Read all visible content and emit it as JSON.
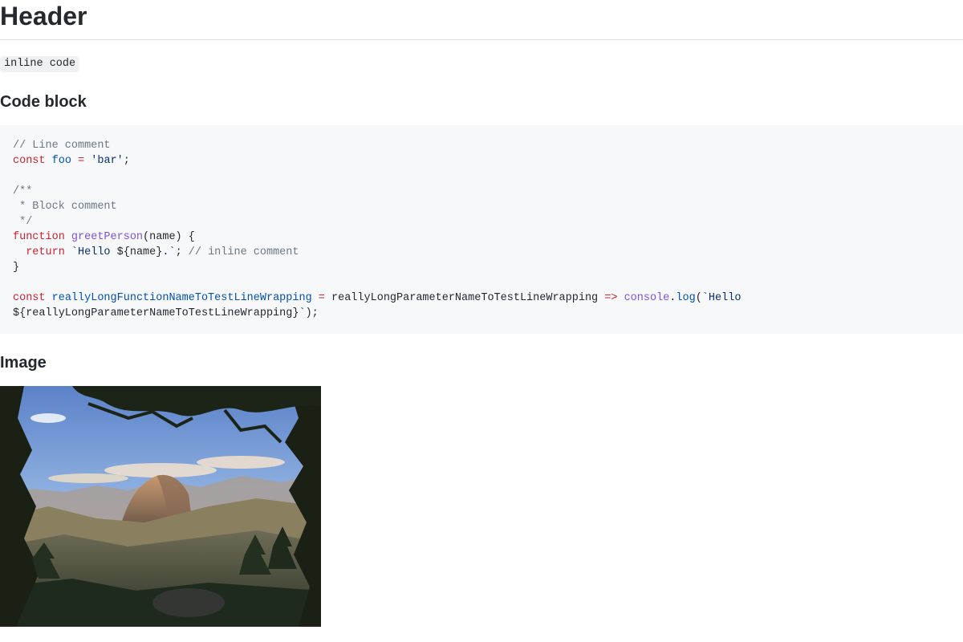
{
  "header": {
    "title": "Header"
  },
  "inline_code": "inline code",
  "sections": {
    "code_block": {
      "title": "Code block"
    },
    "image": {
      "title": "Image"
    }
  },
  "code": {
    "line_comment": "// Line comment",
    "const_kw": "const",
    "foo": "foo",
    "eq": "=",
    "bar": "'bar'",
    "semi": ";",
    "block_comment_1": "/**",
    "block_comment_2": " * Block comment",
    "block_comment_3": " */",
    "function_kw": "function",
    "greet": "greetPerson",
    "params": "(name) {",
    "return_kw": "return",
    "template_open": "`Hello ",
    "template_interp": "${name}",
    "template_close": ".`",
    "stmt_end": "; ",
    "inline_comment": "// inline comment",
    "close_brace": "}",
    "const_kw2": "const",
    "long_fn": "reallyLongFunctionNameToTestLineWrapping",
    "eq2": "=",
    "long_param": " reallyLongParameterNameToTestLineWrapping ",
    "arrow": "=>",
    "console": "console",
    "dot": ".",
    "log": "log",
    "paren_open": "(",
    "tpl2_open": "`Hello",
    "tpl2_interp": "${reallyLongParameterNameToTestLineWrapping}",
    "tpl2_close": "`",
    "end": ");"
  }
}
